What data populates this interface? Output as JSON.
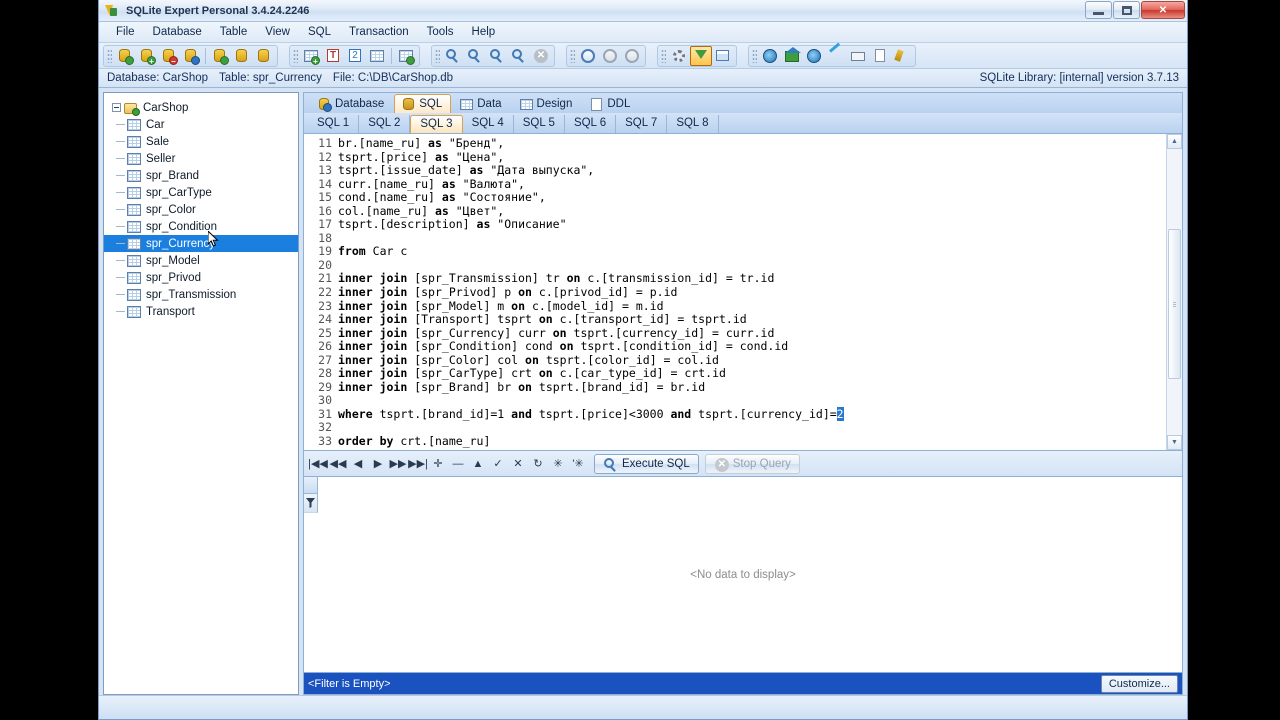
{
  "window": {
    "title": "SQLite Expert Personal 3.4.24.2246",
    "app_icon": "sqlite-expert-icon",
    "minimize_label": "Minimize",
    "maximize_label": "Maximize",
    "close_label": "Close"
  },
  "menu": [
    {
      "label": "File",
      "name": "menu-file"
    },
    {
      "label": "Database",
      "name": "menu-database"
    },
    {
      "label": "Table",
      "name": "menu-table"
    },
    {
      "label": "View",
      "name": "menu-view"
    },
    {
      "label": "SQL",
      "name": "menu-sql"
    },
    {
      "label": "Transaction",
      "name": "menu-transaction"
    },
    {
      "label": "Tools",
      "name": "menu-tools"
    },
    {
      "label": "Help",
      "name": "menu-help"
    }
  ],
  "infobar": {
    "database": "Database: CarShop",
    "table": "Table: spr_Currency",
    "file": "File: C:\\DB\\CarShop.db",
    "library": "SQLite Library: [internal] version 3.7.13"
  },
  "tree": {
    "root": "CarShop",
    "items": [
      "Car",
      "Sale",
      "Seller",
      "spr_Brand",
      "spr_CarType",
      "spr_Color",
      "spr_Condition",
      "spr_Currency",
      "spr_Model",
      "spr_Privod",
      "spr_Transmission",
      "Transport"
    ],
    "selected": "spr_Currency"
  },
  "main_tabs": [
    {
      "label": "Database",
      "icon": "database-icon",
      "active": false
    },
    {
      "label": "SQL",
      "icon": "sql-icon",
      "active": true
    },
    {
      "label": "Data",
      "icon": "data-grid-icon",
      "active": false
    },
    {
      "label": "Design",
      "icon": "design-icon",
      "active": false
    },
    {
      "label": "DDL",
      "icon": "ddl-icon",
      "active": false
    }
  ],
  "sub_tabs": [
    {
      "label": "SQL 1",
      "active": false
    },
    {
      "label": "SQL 2",
      "active": false
    },
    {
      "label": "SQL 3",
      "active": true
    },
    {
      "label": "SQL 4",
      "active": false
    },
    {
      "label": "SQL 5",
      "active": false
    },
    {
      "label": "SQL 6",
      "active": false
    },
    {
      "label": "SQL 7",
      "active": false
    },
    {
      "label": "SQL 8",
      "active": false
    }
  ],
  "editor": {
    "first_visible_line": 11,
    "lines": [
      {
        "n": 11,
        "text": "br.[name_ru] as \"Бренд\","
      },
      {
        "n": 12,
        "text": "tsprt.[price] as \"Цена\","
      },
      {
        "n": 13,
        "text": "tsprt.[issue_date] as \"Дата выпуска\","
      },
      {
        "n": 14,
        "text": "curr.[name_ru] as \"Валюта\","
      },
      {
        "n": 15,
        "text": "cond.[name_ru] as \"Состояние\","
      },
      {
        "n": 16,
        "text": "col.[name_ru] as \"Цвет\","
      },
      {
        "n": 17,
        "text": "tsprt.[description] as \"Описание\""
      },
      {
        "n": 18,
        "text": ""
      },
      {
        "n": 19,
        "text": "from Car c"
      },
      {
        "n": 20,
        "text": ""
      },
      {
        "n": 21,
        "text": "inner join [spr_Transmission] tr on c.[transmission_id] = tr.id"
      },
      {
        "n": 22,
        "text": "inner join [spr_Privod] p on c.[privod_id] = p.id"
      },
      {
        "n": 23,
        "text": "inner join [spr_Model] m on c.[model_id] = m.id"
      },
      {
        "n": 24,
        "text": "inner join [Transport] tsprt on c.[transport_id] = tsprt.id"
      },
      {
        "n": 25,
        "text": "inner join [spr_Currency] curr on tsprt.[currency_id] = curr.id"
      },
      {
        "n": 26,
        "text": "inner join [spr_Condition] cond on tsprt.[condition_id] = cond.id"
      },
      {
        "n": 27,
        "text": "inner join [spr_Color] col on tsprt.[color_id] = col.id"
      },
      {
        "n": 28,
        "text": "inner join [spr_CarType] crt on c.[car_type_id] = crt.id"
      },
      {
        "n": 29,
        "text": "inner join [spr_Brand] br on tsprt.[brand_id] = br.id"
      },
      {
        "n": 30,
        "text": ""
      },
      {
        "n": 31,
        "text": "where tsprt.[brand_id]=1 and tsprt.[price]<3000 and tsprt.[currency_id]=",
        "selection": "2"
      },
      {
        "n": 32,
        "text": ""
      },
      {
        "n": 33,
        "text": "order by crt.[name_ru]"
      }
    ]
  },
  "query_toolbar": {
    "nav_buttons": [
      "first-record",
      "prior-page",
      "prior-record",
      "next-record",
      "next-page",
      "last-record",
      "insert-record",
      "delete-record",
      "edit-record",
      "post-edit",
      "cancel-edit",
      "refresh",
      "apply-filter",
      "clear-filter"
    ],
    "execute_label": "Execute SQL",
    "stop_label": "Stop Query"
  },
  "results": {
    "empty_message": "<No data to display>",
    "filter_text": "<Filter is Empty>",
    "customize_label": "Customize..."
  },
  "colors": {
    "accent_blue": "#1b7fe0",
    "filter_bar": "#1a53c0",
    "active_tab": "#d8a24f",
    "selection": "#2878d0"
  }
}
